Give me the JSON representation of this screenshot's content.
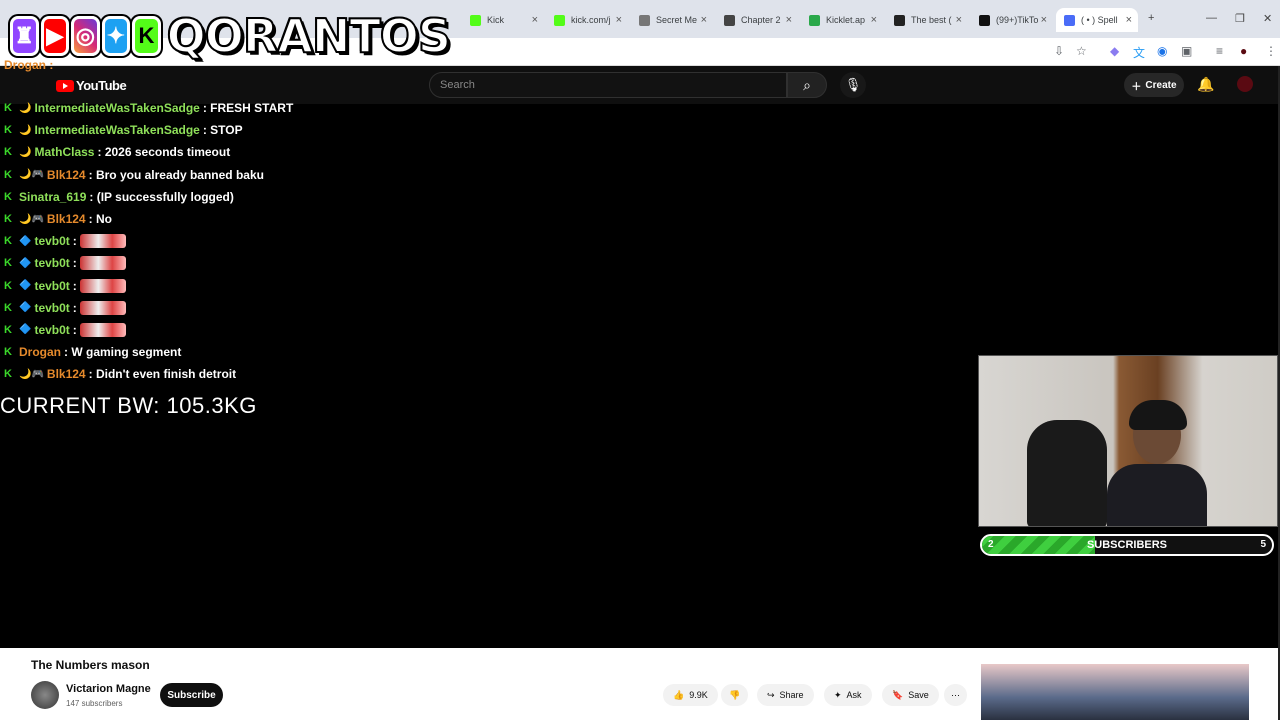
{
  "browser": {
    "tabs": [
      {
        "label": "Kick",
        "fav": "#53fc18"
      },
      {
        "label": "kick.com/j",
        "fav": "#53fc18"
      },
      {
        "label": "Secret Me",
        "fav": "#777777"
      },
      {
        "label": "Chapter 2",
        "fav": "#444444"
      },
      {
        "label": "Kicklet.ap",
        "fav": "#2aa84a"
      },
      {
        "label": "The best (",
        "fav": "#222222"
      },
      {
        "label": "(99+)TikTo",
        "fav": "#111111"
      },
      {
        "label": "( • ) Spell",
        "fav": "#4a6cf7"
      }
    ]
  },
  "banner": {
    "brand": "QORANTOS",
    "icons": [
      "twitch-icon",
      "youtube-icon",
      "instagram-icon",
      "twitter-icon",
      "kick-icon"
    ]
  },
  "youtube": {
    "logo_text": "YouTube",
    "search_placeholder": "Search",
    "create_label": "Create"
  },
  "chat": {
    "top_user": "Drogan :",
    "messages": [
      {
        "user": "IntermediateWasTakenSadge",
        "color": "#8fe05a",
        "badges": "🌙",
        "text": ": FRESH START"
      },
      {
        "user": "IntermediateWasTakenSadge",
        "color": "#8fe05a",
        "badges": "🌙",
        "text": ": STOP"
      },
      {
        "user": "MathClass",
        "color": "#8fe05a",
        "badges": "🌙",
        "text": ": 2026 seconds timeout"
      },
      {
        "user": "Blk124",
        "color": "#e58a2c",
        "badges": "🌙🎮",
        "text": ": Bro you already banned baku"
      },
      {
        "user": "Sinatra_619",
        "color": "#8fe05a",
        "badges": "",
        "text": ": (IP successfully logged)"
      },
      {
        "user": "Blk124",
        "color": "#e58a2c",
        "badges": "🌙🎮",
        "text": ": No"
      },
      {
        "user": "tevb0t",
        "color": "#8fe05a",
        "badges": "🔷",
        "text": ":",
        "emote": true
      },
      {
        "user": "tevb0t",
        "color": "#8fe05a",
        "badges": "🔷",
        "text": ":",
        "emote": true
      },
      {
        "user": "tevb0t",
        "color": "#8fe05a",
        "badges": "🔷",
        "text": ":",
        "emote": true
      },
      {
        "user": "tevb0t",
        "color": "#8fe05a",
        "badges": "🔷",
        "text": ":",
        "emote": true
      },
      {
        "user": "tevb0t",
        "color": "#8fe05a",
        "badges": "🔷",
        "text": ":",
        "emote": true
      },
      {
        "user": "Drogan",
        "color": "#e58a2c",
        "badges": "",
        "text": ": W gaming segment"
      },
      {
        "user": "Blk124",
        "color": "#e58a2c",
        "badges": "🌙🎮",
        "text": ": Didn't even finish detroit"
      }
    ]
  },
  "overlay": {
    "bodyweight": "CURRENT BW: 105.3KG",
    "sub_goal": {
      "start": "2",
      "label": "SUBSCRIBERS",
      "end": "5",
      "progress": 0.39
    }
  },
  "video": {
    "title": "The Numbers mason",
    "channel": "Victarion Magne",
    "subs": "147 subscribers",
    "subscribe_label": "Subscribe",
    "likes": "9.9K",
    "share_label": "Share",
    "ask_label": "Ask",
    "save_label": "Save"
  }
}
